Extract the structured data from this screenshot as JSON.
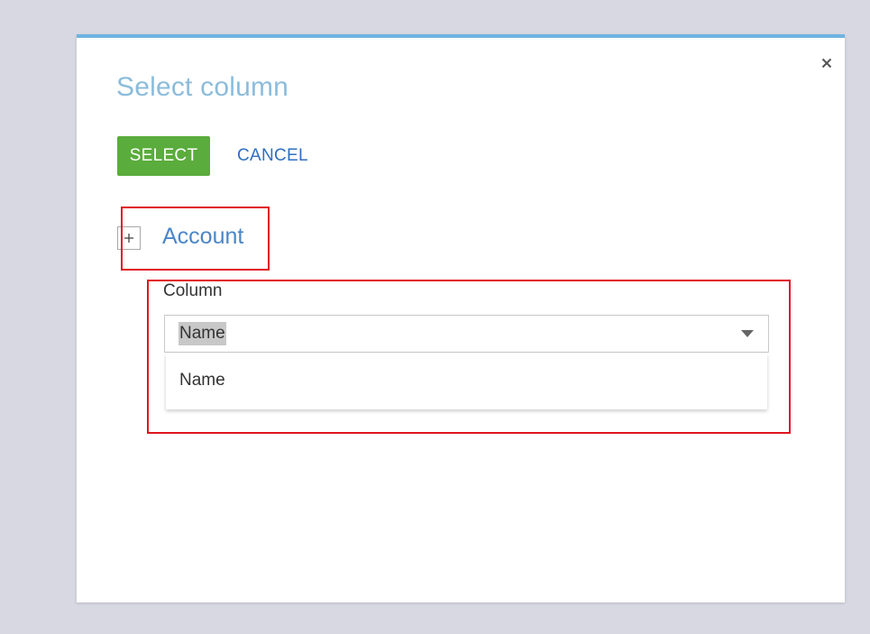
{
  "dialog": {
    "title": "Select column",
    "close_icon": "close-icon"
  },
  "actions": {
    "select_label": "SELECT",
    "cancel_label": "CANCEL"
  },
  "tree": {
    "expand_icon": "plus-icon",
    "group_label": "Account"
  },
  "column_field": {
    "label": "Column",
    "selected_value": "Name",
    "dropdown_icon": "chevron-down-icon",
    "options": [
      "Name"
    ]
  },
  "colors": {
    "accent_bar": "#6fb3e0",
    "title": "#8cbcdb",
    "select_button": "#5aac3c",
    "cancel_link": "#2f6fbf",
    "group_link": "#4a86c8",
    "highlight_box": "#e0141e"
  }
}
